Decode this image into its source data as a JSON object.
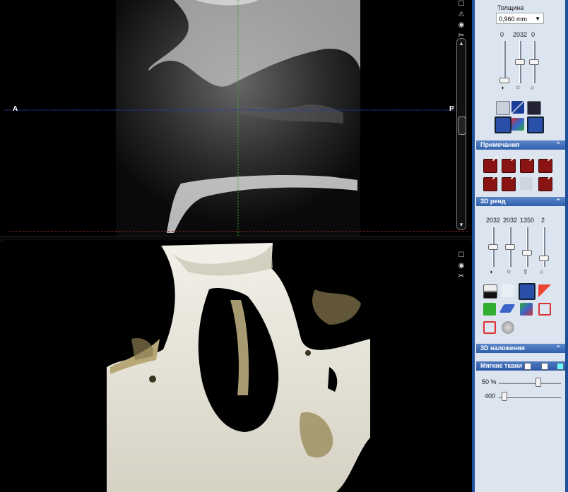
{
  "viewer": {
    "top_left_label": "A",
    "top_right_label": "P"
  },
  "panel": {
    "thickness_label": "Толщина",
    "thickness_value": "0,960 mm",
    "thickness_slider_values": [
      "0",
      "2032",
      "0"
    ],
    "annotations_title": "Примечания",
    "render_title": "3D ренд",
    "render_slider_values": [
      "2032",
      "2032",
      "1350",
      "2"
    ],
    "overlays_title": "3D наложения",
    "soft_tissue_label": "Мягкие ткани",
    "opacity_value": "50 %",
    "level_value": "400",
    "opacity_level": 0.62,
    "tool_level": 0.08
  },
  "icons": [
    "warning-icon",
    "camera-icon",
    "scissors-icon",
    "contrast-icon",
    "brightness-icon",
    "pan-icon",
    "hand-icon",
    "palette-icon",
    "text-note-icon",
    "marker-icon",
    "cube-icon",
    "sphere-icon"
  ],
  "colors": {
    "sidebar_bg": "#dce4ef",
    "sidebar_frame": "#1d4f9a",
    "section_header": "#2f5fae",
    "crosshair_green": "#2fae2f",
    "crosshair_blue": "#2a3ca8",
    "annotation_red": "#8a1414"
  }
}
